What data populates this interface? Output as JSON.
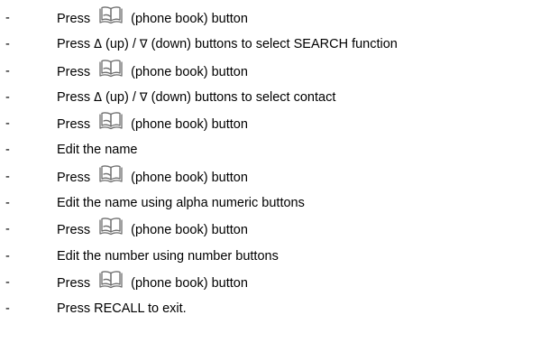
{
  "steps": [
    {
      "dash": "-",
      "parts": [
        {
          "t": "Press "
        },
        {
          "icon": "phone-book-icon"
        },
        {
          "t": " (phone book) button"
        }
      ]
    },
    {
      "dash": "-",
      "parts": [
        {
          "t": "Press "
        },
        {
          "sym": "Δ"
        },
        {
          "t": " (up) / "
        },
        {
          "sym": "∇"
        },
        {
          "t": " (down) buttons to select SEARCH function"
        }
      ]
    },
    {
      "dash": "-",
      "parts": [
        {
          "t": "Press "
        },
        {
          "icon": "phone-book-icon"
        },
        {
          "t": " (phone book) button"
        }
      ]
    },
    {
      "dash": "-",
      "parts": [
        {
          "t": "Press "
        },
        {
          "sym": "Δ"
        },
        {
          "t": " (up) / "
        },
        {
          "sym": "∇"
        },
        {
          "t": " (down) buttons to select contact"
        }
      ]
    },
    {
      "dash": "-",
      "parts": [
        {
          "t": "Press "
        },
        {
          "icon": "phone-book-icon"
        },
        {
          "t": " (phone book) button"
        }
      ]
    },
    {
      "dash": "-",
      "parts": [
        {
          "t": "Edit the name"
        }
      ]
    },
    {
      "dash": "-",
      "parts": [
        {
          "t": "Press "
        },
        {
          "icon": "phone-book-icon"
        },
        {
          "t": " (phone book) button"
        }
      ]
    },
    {
      "dash": "-",
      "parts": [
        {
          "t": "Edit the name using alpha numeric buttons"
        }
      ]
    },
    {
      "dash": "-",
      "parts": [
        {
          "t": "Press "
        },
        {
          "icon": "phone-book-icon"
        },
        {
          "t": " (phone book) button"
        }
      ]
    },
    {
      "dash": "-",
      "parts": [
        {
          "t": "Edit the number using number buttons"
        }
      ]
    },
    {
      "dash": "-",
      "parts": [
        {
          "t": "Press "
        },
        {
          "icon": "phone-book-icon"
        },
        {
          "t": " (phone book) button"
        }
      ]
    },
    {
      "dash": "-",
      "parts": [
        {
          "t": "Press RECALL to exit."
        }
      ]
    }
  ],
  "colors": {
    "text": "#000000",
    "icon_stroke": "#6e6e6e"
  }
}
